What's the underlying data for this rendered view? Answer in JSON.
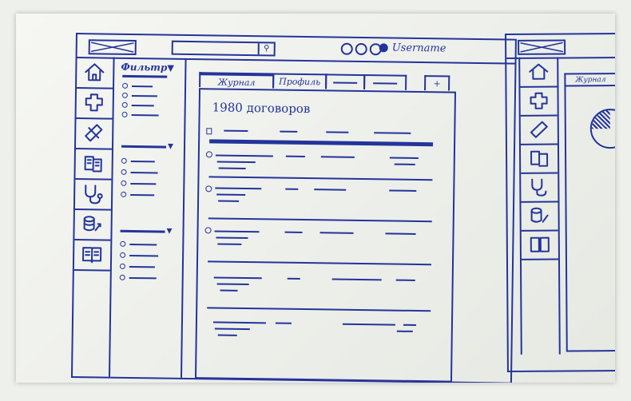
{
  "main_window": {
    "username": "Username",
    "filter": {
      "title": "Фильтр"
    },
    "tabs": [
      {
        "label": "Журнал",
        "active": true
      },
      {
        "label": "Профиль",
        "active": false
      },
      {
        "label": "",
        "active": false
      },
      {
        "label": "",
        "active": false
      },
      {
        "label": "+",
        "active": false
      }
    ],
    "contracts_count": "1980 договоров"
  },
  "sidebar_icons": [
    "house-icon",
    "puzzle-icon",
    "bandage-icon",
    "documents-icon",
    "stethoscope-icon",
    "coins-icon",
    "book-icon"
  ],
  "side_window": {
    "tab_label": "Журнал"
  },
  "colors": {
    "ink": "#24349a",
    "paper": "#f3f4f0",
    "background": "#eef0ec"
  }
}
